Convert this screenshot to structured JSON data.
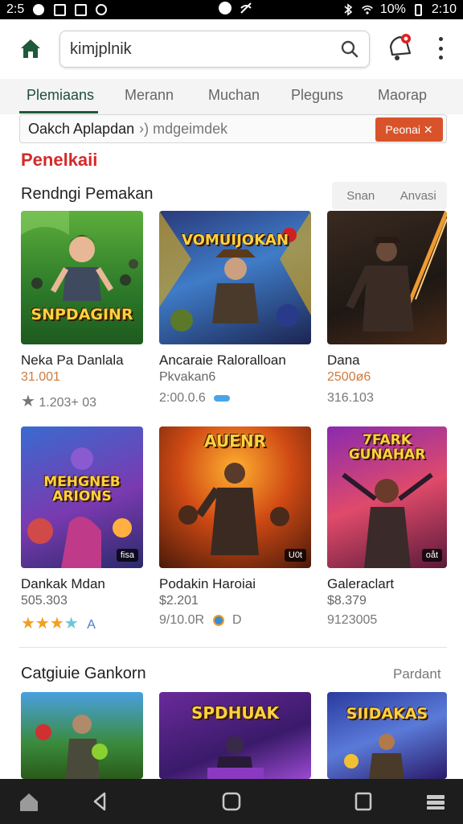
{
  "status_bar": {
    "left_time": "2:5",
    "battery": "10%",
    "clock": "2:10"
  },
  "top_bar": {
    "search_value": "kimjplnik"
  },
  "tabs": [
    {
      "label": "Plemiaans"
    },
    {
      "label": "Merann"
    },
    {
      "label": "Muchan"
    },
    {
      "label": "Pleguns"
    },
    {
      "label": "Maorap"
    }
  ],
  "promo": {
    "text": "Oakch Aplapdan",
    "hint": "›) mdgeimdek",
    "button": "Peonai ✕"
  },
  "section_heading": "Penelkaii",
  "recommended": {
    "title": "Rendngi Pemakan",
    "segments": [
      "Snan",
      "Anvasi"
    ],
    "cards": [
      {
        "name": "Neka Pa Danlala",
        "sub": "31.001",
        "meta": "1.203+ 03",
        "thumb_title": "SNPDAGINR"
      },
      {
        "name": "Ancaraie Raloralloan",
        "sub": "Pkvakan6",
        "meta": "2:00.0.6",
        "thumb_title": "VOMUIJOKAN"
      },
      {
        "name": "Dana",
        "sub": "2500ø6",
        "meta": "316.103",
        "thumb_title": ""
      },
      {
        "name": "Dankak Mdan",
        "sub": "505.303",
        "meta": "A",
        "thumb_title": "MEHGNEB ARIONS",
        "badge": "fisa"
      },
      {
        "name": "Podakin Haroiai",
        "sub": "$2.201",
        "meta": "9/10.0R",
        "meta2": "D",
        "thumb_title": "AUENR",
        "badge": "U0t"
      },
      {
        "name": "Galeraclart",
        "sub": "$8.379",
        "meta": "9123005",
        "thumb_title": "7FARK GUNAHAR",
        "badge": "oåt"
      }
    ]
  },
  "categories": {
    "title": "Catgiuie Gankorn",
    "link": "Pardant",
    "thumb_titles": [
      "",
      "SPDHUAK",
      "SIIDAKAS"
    ]
  },
  "colors": {
    "accent_green": "#1e5a3a",
    "heading_red": "#d42a2a",
    "promo_orange": "#d9532a"
  }
}
